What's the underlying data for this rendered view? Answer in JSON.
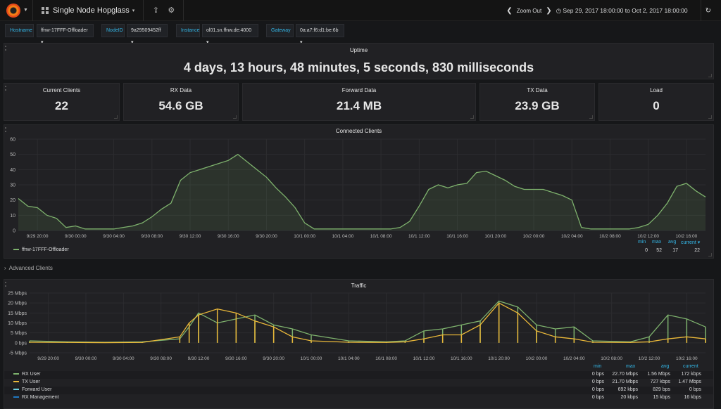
{
  "topbar": {
    "dashboard_title": "Single Node Hopglass",
    "zoom_out": "Zoom Out",
    "time_range": "Sep 29, 2017 18:00:00 to Oct 2, 2017 18:00:00",
    "icons": [
      "grafana-logo",
      "dashboard-grid-icon",
      "share-icon",
      "gear-icon",
      "chevron-left-icon",
      "chevron-right-icon",
      "clock-icon",
      "refresh-icon"
    ]
  },
  "variables": [
    {
      "label": "Hostname",
      "value": "ffnw-17FFF-Offloader"
    },
    {
      "label": "NodeID",
      "value": "9a29509452ff"
    },
    {
      "label": "Instance",
      "value": "ol01.sn.ffnw.de:4000"
    },
    {
      "label": "Gateway",
      "value": "0a:a7:f6:d1:be:6b"
    }
  ],
  "uptime": {
    "title": "Uptime",
    "value": "4 days, 13 hours, 48 minutes, 5 seconds, 830 milliseconds"
  },
  "stats": [
    {
      "title": "Current Clients",
      "value": "22"
    },
    {
      "title": "RX Data",
      "value": "54.6 GB"
    },
    {
      "title": "Forward Data",
      "value": "21.4 MB"
    },
    {
      "title": "TX Data",
      "value": "23.9 GB"
    },
    {
      "title": "Load",
      "value": "0"
    }
  ],
  "clients_panel": {
    "title": "Connected Clients",
    "legend": {
      "headers": [
        "min",
        "max",
        "avg",
        "current"
      ],
      "series": [
        {
          "name": "ffnw-17FFF-Offloader",
          "color": "#7eb26d",
          "min": "0",
          "max": "52",
          "avg": "17",
          "current": "22"
        }
      ]
    }
  },
  "advanced_row": {
    "label": "Advanced Clients"
  },
  "traffic_panel": {
    "title": "Traffic",
    "legend": {
      "headers": [
        "min",
        "max",
        "avg",
        "current"
      ],
      "series": [
        {
          "name": "RX User",
          "color": "#7eb26d",
          "min": "0 bps",
          "max": "22.70 Mbps",
          "avg": "1.56 Mbps",
          "current": "172 kbps"
        },
        {
          "name": "TX User",
          "color": "#eab839",
          "min": "0 bps",
          "max": "21.70 Mbps",
          "avg": "727 kbps",
          "current": "1.47 Mbps"
        },
        {
          "name": "Forward User",
          "color": "#6ed0e0",
          "min": "0 bps",
          "max": "692 kbps",
          "avg": "829 bps",
          "current": "0 bps"
        },
        {
          "name": "RX Management",
          "color": "#1f78c1",
          "min": "0 bps",
          "max": "20 kbps",
          "avg": "15 kbps",
          "current": "16 kbps"
        }
      ]
    }
  },
  "chart_data": [
    {
      "type": "line",
      "title": "Connected Clients",
      "ylim": [
        0,
        60
      ],
      "yticks": [
        "0",
        "10",
        "20",
        "30",
        "40",
        "50",
        "60"
      ],
      "xticks": [
        "9/29 20:00",
        "9/30 00:00",
        "9/30 04:00",
        "9/30 08:00",
        "9/30 12:00",
        "9/30 16:00",
        "9/30 20:00",
        "10/1 00:00",
        "10/1 04:00",
        "10/1 08:00",
        "10/1 12:00",
        "10/1 16:00",
        "10/1 20:00",
        "10/2 00:00",
        "10/2 04:00",
        "10/2 08:00",
        "10/2 12:00",
        "10/2 16:00"
      ],
      "series": [
        {
          "name": "ffnw-17FFF-Offloader",
          "color": "#7eb26d",
          "x_hours": [
            0,
            1,
            2,
            3,
            4,
            5,
            6,
            7,
            8,
            9,
            10,
            11,
            12,
            13,
            14,
            15,
            16,
            17,
            18,
            19,
            20,
            21,
            22,
            23,
            24,
            25,
            26,
            27,
            28,
            29,
            30,
            31,
            32,
            33,
            34,
            35,
            36,
            37,
            38,
            39,
            40,
            41,
            42,
            43,
            44,
            45,
            46,
            47,
            48,
            49,
            50,
            51,
            52,
            53,
            54,
            55,
            56,
            57,
            58,
            59,
            60,
            61,
            62,
            63,
            64,
            65,
            66,
            67,
            68,
            69,
            70,
            71,
            72
          ],
          "values": [
            21,
            16,
            15,
            10,
            8,
            2,
            3,
            1,
            1,
            1,
            1,
            2,
            3,
            5,
            9,
            14,
            18,
            33,
            38,
            40,
            42,
            44,
            46,
            50,
            45,
            40,
            35,
            28,
            22,
            15,
            5,
            1,
            1,
            1,
            1,
            1,
            1,
            1,
            1,
            1,
            2,
            6,
            16,
            27,
            30,
            28,
            30,
            31,
            38,
            39,
            36,
            33,
            29,
            27,
            27,
            27,
            25,
            23,
            20,
            2,
            1,
            1,
            1,
            1,
            1,
            2,
            4,
            10,
            18,
            29,
            31,
            26,
            22
          ]
        }
      ]
    },
    {
      "type": "line",
      "title": "Traffic",
      "ylim": [
        -5,
        25
      ],
      "yticks": [
        "-5 Mbps",
        "0 bps",
        "5 Mbps",
        "10 Mbps",
        "15 Mbps",
        "20 Mbps",
        "25 Mbps"
      ],
      "xticks": [
        "9/29 20:00",
        "9/30 00:00",
        "9/30 04:00",
        "9/30 08:00",
        "9/30 12:00",
        "9/30 16:00",
        "9/30 20:00",
        "10/1 00:00",
        "10/1 04:00",
        "10/1 08:00",
        "10/1 12:00",
        "10/1 16:00",
        "10/1 20:00",
        "10/2 00:00",
        "10/2 04:00",
        "10/2 08:00",
        "10/2 12:00",
        "10/2 16:00"
      ],
      "series": [
        {
          "name": "RX User",
          "color": "#7eb26d",
          "x_hours": [
            0,
            4,
            8,
            12,
            16,
            17,
            18,
            20,
            22,
            24,
            26,
            28,
            30,
            34,
            38,
            40,
            42,
            44,
            46,
            48,
            50,
            52,
            54,
            56,
            58,
            60,
            64,
            66,
            68,
            70,
            72
          ],
          "values": [
            1,
            0.5,
            0.3,
            0.5,
            2,
            8,
            15,
            10,
            12,
            14,
            9,
            7,
            4,
            1,
            0.5,
            1,
            6,
            7,
            9,
            11,
            21,
            18,
            9,
            7,
            8,
            1,
            0.5,
            3,
            14,
            12,
            8
          ]
        },
        {
          "name": "TX User",
          "color": "#eab839",
          "x_hours": [
            0,
            4,
            8,
            12,
            16,
            17,
            18,
            20,
            22,
            24,
            26,
            28,
            30,
            34,
            38,
            40,
            42,
            44,
            46,
            48,
            50,
            52,
            54,
            56,
            58,
            60,
            64,
            66,
            68,
            70,
            72
          ],
          "values": [
            0.3,
            0.2,
            0.1,
            0.2,
            3,
            10,
            14,
            17,
            15,
            11,
            8,
            3,
            1,
            0.3,
            0.2,
            0.5,
            2,
            4,
            4,
            9,
            20,
            15,
            6,
            3,
            2,
            0.3,
            0.2,
            0.5,
            2,
            3,
            2
          ]
        }
      ]
    }
  ]
}
